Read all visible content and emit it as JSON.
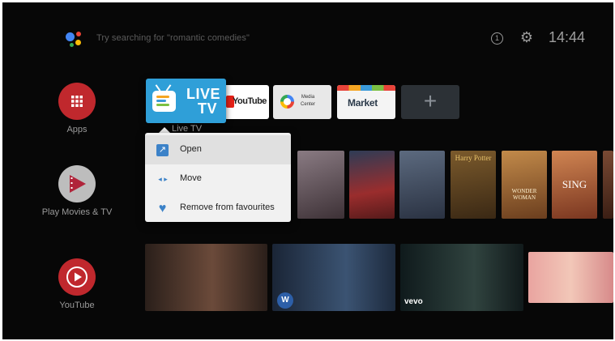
{
  "search": {
    "placeholder": "Try searching for \"romantic comedies\""
  },
  "status": {
    "time": "14:44",
    "timer_glyph": "1"
  },
  "sidebar": [
    {
      "label": "Apps",
      "icon": "apps-grid-icon",
      "color": "#c0282d"
    },
    {
      "label": "Play Movies & TV",
      "icon": "play-movies-icon",
      "color": "#bdbdbd"
    },
    {
      "label": "YouTube",
      "icon": "youtube-icon",
      "color": "#c0282d"
    }
  ],
  "favourites": {
    "live_tv": {
      "text_line1": "LIVE",
      "text_line2": "TV",
      "caption": "Live TV",
      "bg": "#2f9fd8"
    },
    "youtube": {
      "label": "YouTube"
    },
    "media_center": {
      "line1": "Media",
      "line2": "Center"
    },
    "market": {
      "label": "Market"
    },
    "add": {
      "glyph": "+"
    }
  },
  "context_menu": {
    "items": [
      {
        "label": "Open",
        "icon": "open-external-icon",
        "glyph": "↗"
      },
      {
        "label": "Move",
        "icon": "move-arrows-icon",
        "glyph": "◂ ▸"
      },
      {
        "label": "Remove from favourites",
        "icon": "heart-icon",
        "glyph": "♥"
      }
    ]
  },
  "posters": [
    {
      "title": "",
      "bg": "#6b5d63"
    },
    {
      "title": "",
      "bg": "#8b2a2a"
    },
    {
      "title": "",
      "bg": "#3a4454"
    },
    {
      "title": "Harry Potter",
      "bg": "#5a4226"
    },
    {
      "title": "WONDER WOMAN",
      "bg": "#8a5a2e"
    },
    {
      "title": "SING",
      "bg": "#b25d3a"
    },
    {
      "title": "",
      "bg": "#5a3326"
    }
  ],
  "videos": [
    {
      "label": "",
      "bg": "#3a2a24"
    },
    {
      "label": "",
      "bg": "#2b3b52"
    },
    {
      "label": "vevo",
      "bg": "#1e2a2c"
    },
    {
      "label": "",
      "bg": "#d78a8a"
    }
  ]
}
